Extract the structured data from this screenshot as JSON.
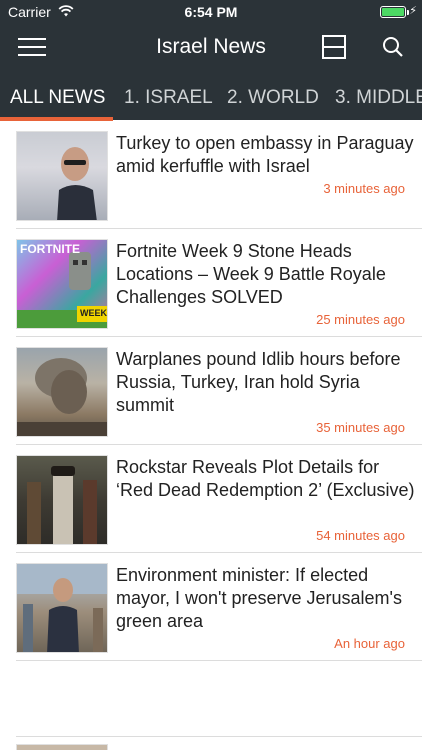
{
  "status_bar": {
    "carrier": "Carrier",
    "time": "6:54 PM",
    "battery_level": 1.0,
    "charging_glyph": "⚡",
    "icons": [
      "wifi-icon",
      "battery-icon"
    ]
  },
  "navbar": {
    "title": "Israel News",
    "icons": [
      "hamburger-menu-icon",
      "layout-toggle-icon",
      "search-icon"
    ]
  },
  "tabs": [
    {
      "label": "ALL NEWS",
      "active": true
    },
    {
      "label": "1. ISRAEL",
      "active": false
    },
    {
      "label": "2. WORLD",
      "active": false
    },
    {
      "label": "3. MIDDLE",
      "active": false
    }
  ],
  "colors": {
    "header_bg": "#2b3338",
    "accent": "#e86339",
    "divider": "#dcdcdc"
  },
  "articles": [
    {
      "headline": "Turkey to open embassy in Paraguay amid kerfuffle with Israel",
      "time_ago": "3 minutes ago",
      "thumbnail": "photo-man-in-suit"
    },
    {
      "headline": "Fortnite Week 9 Stone Heads Locations – Week 9 Battle Royale Challenges SOLVED",
      "time_ago": "25 minutes ago",
      "thumbnail": "fortnite-artwork",
      "thumb_text_top": "FORTNITE",
      "thumb_text_bottom": "WEEK"
    },
    {
      "headline": "Warplanes pound Idlib hours before Russia, Turkey, Iran hold Syria summit",
      "time_ago": "35 minutes ago",
      "thumbnail": "smoke-plume-photo"
    },
    {
      "headline": "Rockstar Reveals Plot Details for ‘Red Dead Redemption 2’ (Exclusive)",
      "time_ago": "54 minutes ago",
      "thumbnail": "red-dead-characters"
    },
    {
      "headline": "Environment minister: If elected mayor, I won't preserve Jerusalem's green area",
      "time_ago": "An hour ago",
      "thumbnail": "man-on-street-photo"
    }
  ]
}
